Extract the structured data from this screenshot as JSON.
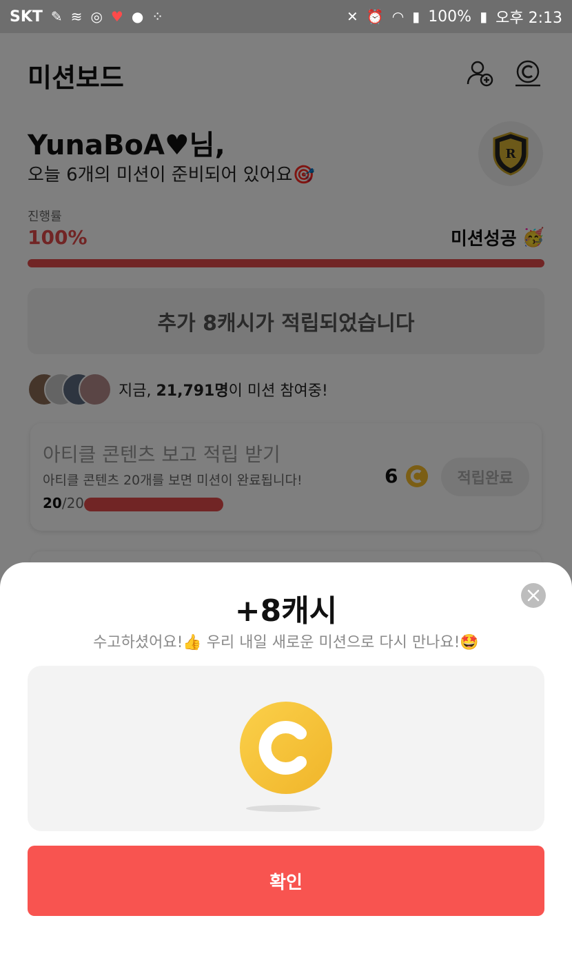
{
  "status_bar": {
    "carrier": "SKT",
    "battery": "100%",
    "time": "오후 2:13",
    "left_icons": [
      "bandage-icon",
      "wave-icon",
      "ok-circle-icon",
      "heart-icon",
      "lock-icon",
      "grid-icon"
    ],
    "right_icons": [
      "mute-icon",
      "alarm-icon",
      "wifi-icon",
      "signal-icon",
      "battery-icon"
    ]
  },
  "header": {
    "title": "미션보드",
    "icons": [
      "add-friend-icon",
      "cash-icon"
    ]
  },
  "greeting": {
    "name": "YunaBoA♥님,",
    "subtitle": "오늘 6개의 미션이 준비되어 있어요🎯"
  },
  "progress": {
    "label": "진행률",
    "value_text": "100%",
    "fraction": 1.0,
    "success_text": "미션성공",
    "success_emoji": "🥳"
  },
  "banner": {
    "text": "추가 8캐시가 적립되었습니다"
  },
  "participants": {
    "prefix": "지금, ",
    "count": "21,791명",
    "suffix": "이 미션 참여중!"
  },
  "mission": {
    "title": "아티클 콘텐츠 보고 적립 받기",
    "description": "아티클 콘텐츠 20개를 보면 미션이 완료됩니다!",
    "count_done": "20",
    "count_total": "/20",
    "progress_fraction": 1.0,
    "reward": "6",
    "button_label": "적립완료"
  },
  "sheet": {
    "title": "+8캐시",
    "subtitle": "수고하셨어요!👍 우리 내일 새로운 미션으로 다시 만나요!🤩",
    "confirm_label": "확인"
  },
  "colors": {
    "accent_red": "#e34a4a",
    "button_red": "#f85450",
    "coin_yellow": "#f6bd2b"
  }
}
